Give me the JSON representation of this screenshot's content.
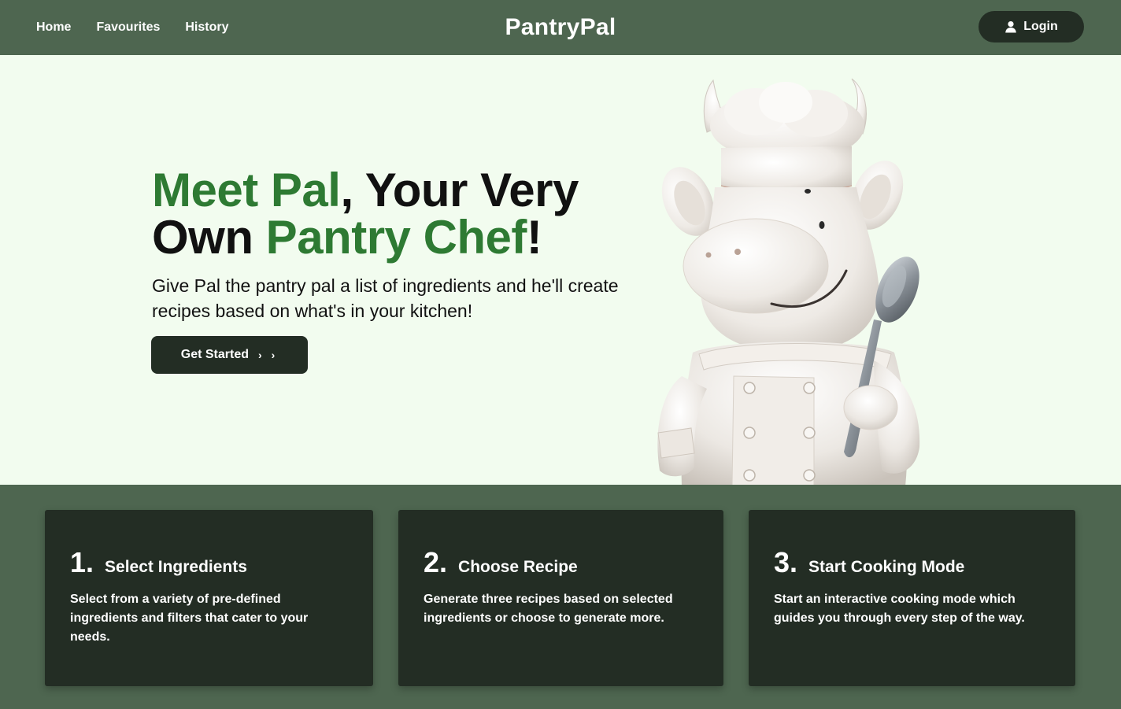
{
  "nav": {
    "links": [
      "Home",
      "Favourites",
      "History"
    ],
    "brand": "PantryPal",
    "login_label": "Login"
  },
  "hero": {
    "title_part1": "Meet Pal",
    "title_part2": ", Your Very Own ",
    "title_part3": "Pantry Chef",
    "title_part4": "!",
    "subtitle": "Give Pal the pantry pal a list of ingredients and he'll create recipes based on what's in your kitchen!",
    "cta_label": "Get Started",
    "cta_icon": "double-chevron-right",
    "mascot": "chef-cow-mascot-holding-spoon"
  },
  "steps": [
    {
      "num": "1.",
      "title": "Select Ingredients",
      "desc": "Select from a variety of pre-defined ingredients and filters that cater to your needs."
    },
    {
      "num": "2.",
      "title": "Choose Recipe",
      "desc": "Generate three recipes based on selected ingredients or choose to generate more."
    },
    {
      "num": "3.",
      "title": "Start Cooking Mode",
      "desc": "Start an interactive cooking mode which guides you through every step of the way."
    }
  ],
  "colors": {
    "nav_bg": "#4e6650",
    "dark": "#232d24",
    "hero_bg": "#f2fcef",
    "accent_green": "#2e7a33"
  }
}
